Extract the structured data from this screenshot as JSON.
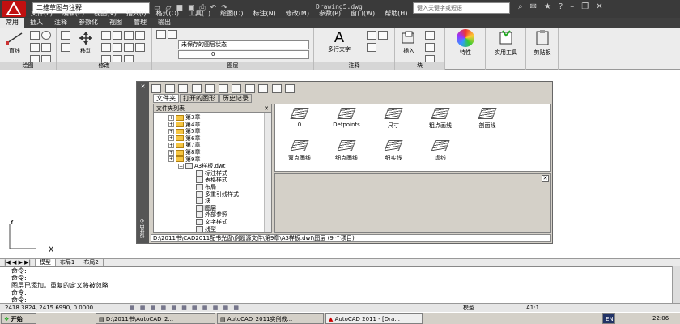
{
  "titlebar": {
    "workspace": "二维草图与注释",
    "document": "Drawing5.dwg",
    "search_placeholder": "键入关键字或短语"
  },
  "menu": [
    "文件(F)",
    "编辑(E)",
    "视图(V)",
    "插入(I)",
    "格式(O)",
    "工具(T)",
    "绘图(D)",
    "标注(N)",
    "修改(M)",
    "参数(P)",
    "窗口(W)",
    "帮助(H)"
  ],
  "ribbon_tabs": [
    "常用",
    "插入",
    "注释",
    "参数化",
    "视图",
    "管理",
    "输出"
  ],
  "ribbon": {
    "draw": {
      "line": "直线",
      "label": "绘图"
    },
    "modify": {
      "move": "移动",
      "label": "修改"
    },
    "layers": {
      "state": "未保存的图层状态",
      "current": "0",
      "label": "图层"
    },
    "annotation": {
      "multiline_text": "多行文字",
      "label": "注释"
    },
    "block": {
      "insert": "插入",
      "label": "块"
    },
    "properties": {
      "label": "特性"
    },
    "utilities": {
      "label": "实用工具"
    },
    "clipboard": {
      "label": "剪贴板"
    }
  },
  "design_center": {
    "title": "设计中心",
    "tabs": [
      "文件夹",
      "打开的图形",
      "历史记录"
    ],
    "tree_header": "文件夹列表",
    "tree": [
      "第3章",
      "第4章",
      "第5章",
      "第6章",
      "第7章",
      "第8章",
      "第9章",
      "A3样板.dwt",
      "标注样式",
      "表格样式",
      "布局",
      "多重引线样式",
      "块",
      "图层",
      "外部参照",
      "文字样式",
      "线型"
    ],
    "layers": [
      "0",
      "Defpoints",
      "尺寸",
      "粗点画线",
      "剖面线",
      "双点画线",
      "细点画线",
      "细实线",
      "虚线"
    ],
    "path": "D:\\2011书\\CAD2011配书光盘\\例题源文件\\第9章\\A3样板.dwt\\图层  (9 个项目)"
  },
  "layout_tabs": [
    "模型",
    "布局1",
    "布局2"
  ],
  "command_lines": [
    "命令:",
    "命令:",
    "图层已添加。重复的定义将被忽略",
    "命令:",
    "命令:"
  ],
  "status": {
    "coords": "2418.3824, 2415.6990, 0.0000",
    "model": "模型",
    "scale": "A1:1"
  },
  "taskbar": {
    "start": "开始",
    "items": [
      "D:\\2011书\\AutoCAD_2...",
      "AutoCAD_2011实例教...",
      "AutoCAD 2011 - [Dra..."
    ],
    "lang": "EN",
    "time": "22:06"
  }
}
